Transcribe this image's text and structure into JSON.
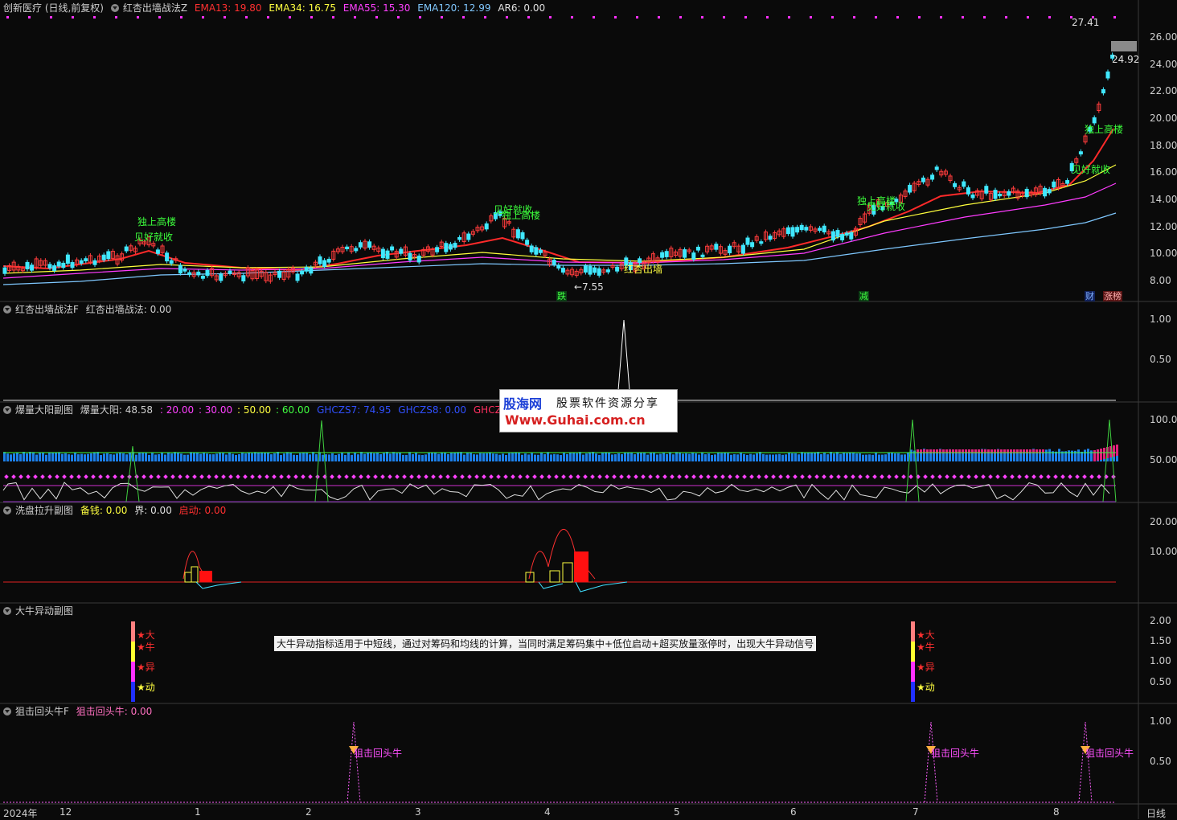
{
  "main": {
    "stock": "创新医疗 (日线,前复权)",
    "indicator": "红杏出墙战法Z",
    "ema13": "EMA13: 19.80",
    "ema34": "EMA34: 16.75",
    "ema55": "EMA55: 15.30",
    "ema120": "EMA120: 12.99",
    "ar6": "AR6: 0.00",
    "yticks": [
      "26.00",
      "24.00",
      "22.00",
      "20.00",
      "18.00",
      "16.00",
      "14.00",
      "12.00",
      "10.00",
      "8.00"
    ],
    "high_label": "27.41",
    "low_label": "←7.55",
    "last_price": "24.92",
    "annotations": {
      "a1": "独上高楼",
      "a2": "见好就收",
      "a3": "见好就收",
      "a4": "独上高楼",
      "a5": "独上高楼",
      "a6": "见好就收",
      "a7": "独上高楼",
      "a8": "见好就收",
      "a9": "红杏出墙"
    },
    "badges": {
      "b1": "跌",
      "b2": "减",
      "b3": "财",
      "b4": "涨榜"
    }
  },
  "p1": {
    "name": "红杏出墙战法F",
    "value": "红杏出墙战法: 0.00",
    "yticks": [
      "1.00",
      "0.50"
    ]
  },
  "p2": {
    "name": "爆量大阳副图",
    "value": "爆量大阳: 48.58",
    "v1": ": 20.00",
    "v2": ": 30.00",
    "v3": ": 50.00",
    "v4": ": 60.00",
    "g7": "GHCZS7: 74.95",
    "g8": "GHCZS8: 0.00",
    "g9": "GHCZS9: 74.95",
    "yticks": [
      "100.00",
      "50.00"
    ]
  },
  "p3": {
    "name": "洗盘拉升副图",
    "v1": "备钱: 0.00",
    "v2": "界: 0.00",
    "v3": "启动: 0.00",
    "yticks": [
      "20.00",
      "10.00"
    ]
  },
  "p4": {
    "name": "大牛异动副图",
    "yticks": [
      "2.00",
      "1.50",
      "1.00",
      "0.50"
    ],
    "desc": "大牛异动指标适用于中短线，通过对筹码和均线的计算，当同时满足筹码集中+低位启动+超买放量涨停时，出现大牛异动信号",
    "s1": "★大",
    "s2": "★牛",
    "s3": "★异",
    "s4": "★动"
  },
  "p5": {
    "name": "狙击回头牛F",
    "value": "狙击回头牛: 0.00",
    "yticks": [
      "1.00",
      "0.50"
    ],
    "label": "狙击回头牛"
  },
  "xaxis": {
    "labels": [
      "2024年",
      "12",
      "1",
      "2",
      "3",
      "4",
      "5",
      "6",
      "7",
      "8"
    ],
    "period": "日线"
  },
  "watermark": {
    "t1": "股海网",
    "t2": "股票软件资源分享",
    "t3": "Www.Guhai.com.cn"
  },
  "colors": {
    "ema13": "#ff2a2a",
    "ema34": "#ffff3c",
    "ema55": "#ff3cff",
    "ema120": "#7fc8ff",
    "up": "#ff3c3c",
    "down": "#40e8ff"
  }
}
